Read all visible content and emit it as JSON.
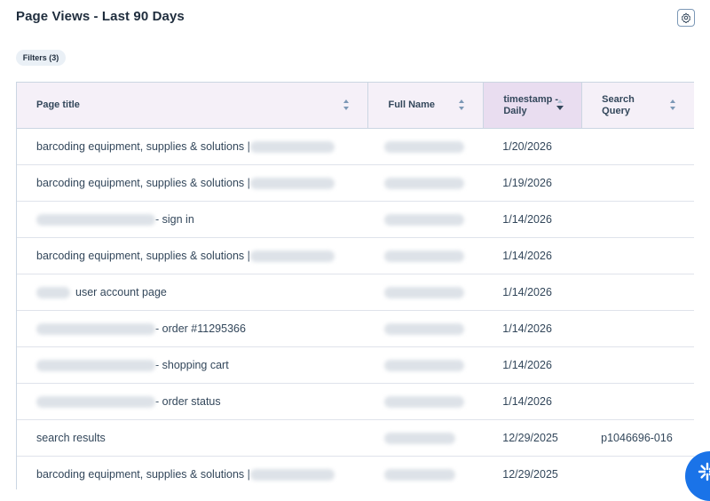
{
  "header": {
    "title": "Page Views - Last 90 Days"
  },
  "filters": {
    "label": "Filters (3)"
  },
  "icons": {
    "settings": "gear-icon",
    "sort": "sort-icon",
    "sort_desc": "sort-desc-icon",
    "chat": "chat-spark-icon"
  },
  "colors": {
    "header_bg": "#f5f0f8",
    "sorted_header_bg": "#e9ddf0",
    "fab": "#1a73e8"
  },
  "table": {
    "columns": [
      "Page title",
      "Full Name",
      "timestamp - Daily",
      "Search Query"
    ],
    "rows": [
      {
        "title": "barcoding equipment, supplies & solutions | ",
        "date": "1/20/2026",
        "query": ""
      },
      {
        "title": "barcoding equipment, supplies & solutions | ",
        "date": "1/19/2026",
        "query": ""
      },
      {
        "title": " - sign in",
        "date": "1/14/2026",
        "query": ""
      },
      {
        "title": "barcoding equipment, supplies & solutions | ",
        "date": "1/14/2026",
        "query": ""
      },
      {
        "title": "user account page",
        "date": "1/14/2026",
        "query": ""
      },
      {
        "title": " - order #11295366",
        "date": "1/14/2026",
        "query": ""
      },
      {
        "title": " - shopping cart",
        "date": "1/14/2026",
        "query": ""
      },
      {
        "title": " - order status",
        "date": "1/14/2026",
        "query": ""
      },
      {
        "title": "search results",
        "date": "12/29/2025",
        "query": "p1046696-016"
      },
      {
        "title": "barcoding equipment, supplies & solutions | ",
        "date": "12/29/2025",
        "query": ""
      }
    ]
  }
}
